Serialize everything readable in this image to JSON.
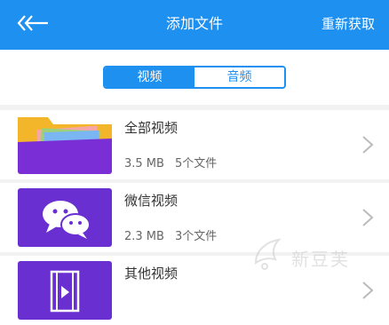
{
  "header": {
    "title": "添加文件",
    "action_label": "重新获取",
    "back_icon": "back-arrow-icon",
    "background": "#1e90f0"
  },
  "tabs": [
    {
      "label": "视频",
      "active": true
    },
    {
      "label": "音频",
      "active": false
    }
  ],
  "items": [
    {
      "name": "全部视频",
      "size": "3.5 MB",
      "count": "5个文件",
      "icon": "folder-icon"
    },
    {
      "name": "微信视频",
      "size": "2.3 MB",
      "count": "3个文件",
      "icon": "wechat-icon"
    },
    {
      "name": "其他视频",
      "size": "",
      "count": "",
      "icon": "video-file-icon"
    }
  ],
  "watermark": {
    "text": "新豆芙"
  },
  "colors": {
    "accent": "#1e90f0",
    "tile": "#6a2fd0"
  }
}
